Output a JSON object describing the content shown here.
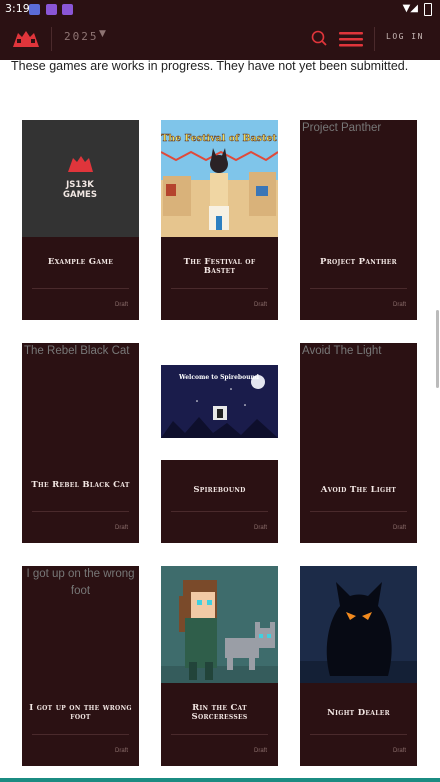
{
  "status_bar": {
    "time": "3:19"
  },
  "header": {
    "logo_text": "JS13K GAMES",
    "year": "2025",
    "login": "LOG IN"
  },
  "intro": "These games are works in progress. They have not yet been submitted.",
  "colors": {
    "brand_dark": "#2b1113",
    "accent_red": "#e0353b",
    "status_text": "#8a6d6b"
  },
  "games": [
    {
      "title": "Example Game",
      "status": "Draft",
      "thumb": "logo",
      "logo_line1": "JS13K",
      "logo_line2": "GAMES"
    },
    {
      "title": "The Festival of Bastet",
      "status": "Draft",
      "thumb": "festival",
      "banner": "The Festival of Bastet"
    },
    {
      "title": "Project Panther",
      "status": "Draft",
      "thumb": "broken",
      "alt": "Project Panther"
    },
    {
      "title": "The Rebel Black Cat",
      "status": "Draft",
      "thumb": "broken",
      "alt": "The Rebel Black Cat"
    },
    {
      "title": "Spirebound",
      "status": "Draft",
      "thumb": "spire",
      "banner": "Welcome to Spirebound"
    },
    {
      "title": "Avoid The Light",
      "status": "Draft",
      "thumb": "broken",
      "alt": "Avoid The Light"
    },
    {
      "title": "I got up on the wrong foot",
      "status": "Draft",
      "thumb": "broken",
      "alt": "I got up on the wrong foot"
    },
    {
      "title": "Rin the Cat Sorceresses",
      "status": "Draft",
      "thumb": "pixel"
    },
    {
      "title": "Night Dealer",
      "status": "Draft",
      "thumb": "night"
    }
  ]
}
